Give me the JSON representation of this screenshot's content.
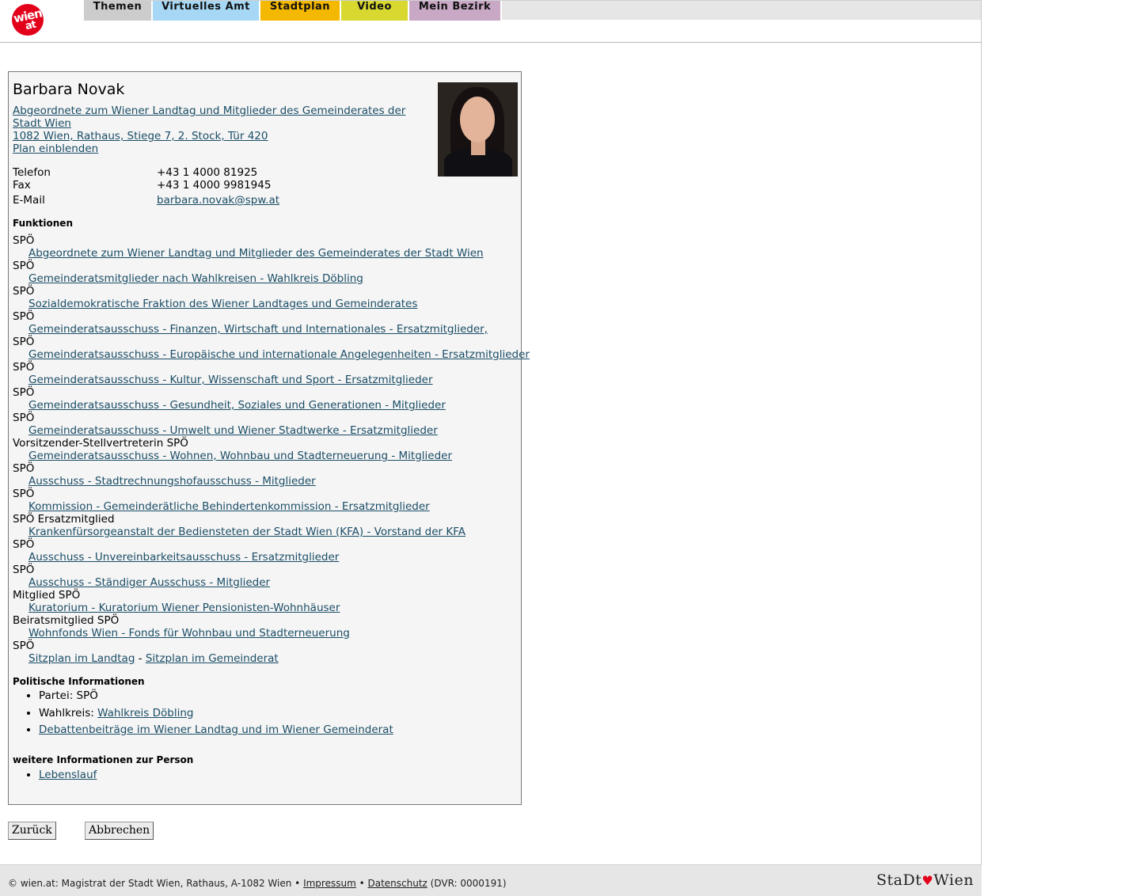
{
  "header": {
    "logo_text_1": "wien",
    "logo_text_2": "at",
    "tabs": [
      {
        "label": "Themen",
        "color": "#cccccc"
      },
      {
        "label": "Virtuelles Amt",
        "color": "#a6d8f5"
      },
      {
        "label": "Stadtplan",
        "color": "#f5b800"
      },
      {
        "label": "Video",
        "color": "#d8d831"
      },
      {
        "label": "Mein Bezirk",
        "color": "#c9a8c6"
      }
    ]
  },
  "person": {
    "name": "Barbara Novak",
    "title_line1": "Abgeordnete zum Wiener Landtag und Mitglieder des Gemeinderates der",
    "title_line2": "Stadt Wien",
    "address": "1082 Wien, Rathaus, Stiege 7, 2. Stock, Tür 420",
    "plan_link": "Plan einblenden",
    "contact": {
      "phone_label": "Telefon",
      "phone": "+43 1 4000 81925",
      "fax_label": "Fax",
      "fax": "+43 1 4000 9981945",
      "email_label": "E-Mail",
      "email": "barbara.novak@spw.at"
    }
  },
  "functions": {
    "heading": "Funktionen",
    "items": [
      {
        "party": "SPÖ",
        "link": "Abgeordnete zum Wiener Landtag und Mitglieder des Gemeinderates der Stadt Wien"
      },
      {
        "party": "SPÖ",
        "link": "Gemeinderatsmitglieder nach Wahlkreisen - Wahlkreis Döbling"
      },
      {
        "party": "SPÖ",
        "link": "Sozialdemokratische Fraktion des Wiener Landtages und Gemeinderates"
      },
      {
        "party": "SPÖ",
        "link": "Gemeinderatsausschuss - Finanzen, Wirtschaft und Internationales - Ersatzmitglieder, "
      },
      {
        "party": "SPÖ",
        "link": "Gemeinderatsausschuss - Europäische und internationale Angelegenheiten - Ersatzmitglieder"
      },
      {
        "party": "SPÖ",
        "link": "Gemeinderatsausschuss - Kultur, Wissenschaft und Sport - Ersatzmitglieder"
      },
      {
        "party": "SPÖ",
        "link": "Gemeinderatsausschuss - Gesundheit, Soziales und Generationen - Mitglieder"
      },
      {
        "party": "SPÖ",
        "link": "Gemeinderatsausschuss - Umwelt und Wiener Stadtwerke - Ersatzmitglieder"
      },
      {
        "party": "Vorsitzender-Stellvertreterin SPÖ",
        "link": "Gemeinderatsausschuss - Wohnen, Wohnbau und Stadterneuerung - Mitglieder"
      },
      {
        "party": "SPÖ",
        "link": "Ausschuss - Stadtrechnungshofausschuss - Mitglieder"
      },
      {
        "party": "SPÖ",
        "link": "Kommission - Gemeinderätliche Behindertenkommission - Ersatzmitglieder"
      },
      {
        "party": "SPÖ Ersatzmitglied",
        "link": "Krankenfürsorgeanstalt der Bediensteten der Stadt Wien (KFA) - Vorstand der KFA"
      },
      {
        "party": "SPÖ",
        "link": "Ausschuss - Unvereinbarkeitsausschuss - Ersatzmitglieder"
      },
      {
        "party": "SPÖ",
        "link": "Ausschuss - Ständiger Ausschuss - Mitglieder"
      },
      {
        "party": "Mitglied SPÖ",
        "link": "Kuratorium - Kuratorium Wiener Pensionisten-Wohnhäuser"
      },
      {
        "party": "Beiratsmitglied SPÖ",
        "link": "Wohnfonds Wien - Fonds für Wohnbau und Stadterneuerung"
      }
    ],
    "last_party": "SPÖ",
    "seat_link_1": "Sitzplan im Landtag",
    "seat_separator": " - ",
    "seat_link_2": "Sitzplan im Gemeinderat"
  },
  "political": {
    "heading": "Politische Informationen",
    "party_label": "Partei: SPÖ",
    "constituency_label": "Wahlkreis: ",
    "constituency_link": "Wahlkreis Döbling",
    "debate_link": "Debattenbeiträge im Wiener Landtag und im Wiener Gemeinderat"
  },
  "more": {
    "heading": "weitere Informationen zur Person",
    "cv_link": "Lebenslauf"
  },
  "buttons": {
    "back": "Zurück",
    "cancel": "Abbrechen"
  },
  "footer": {
    "text": "© wien.at: Magistrat der Stadt Wien, Rathaus, A-1082 Wien • ",
    "impressum": "Impressum",
    "bullet": " • ",
    "datenschutz": "Datenschutz",
    "dvr": " (DVR: 0000191)",
    "brand_1": "StaDt",
    "brand_2": "Wien"
  }
}
